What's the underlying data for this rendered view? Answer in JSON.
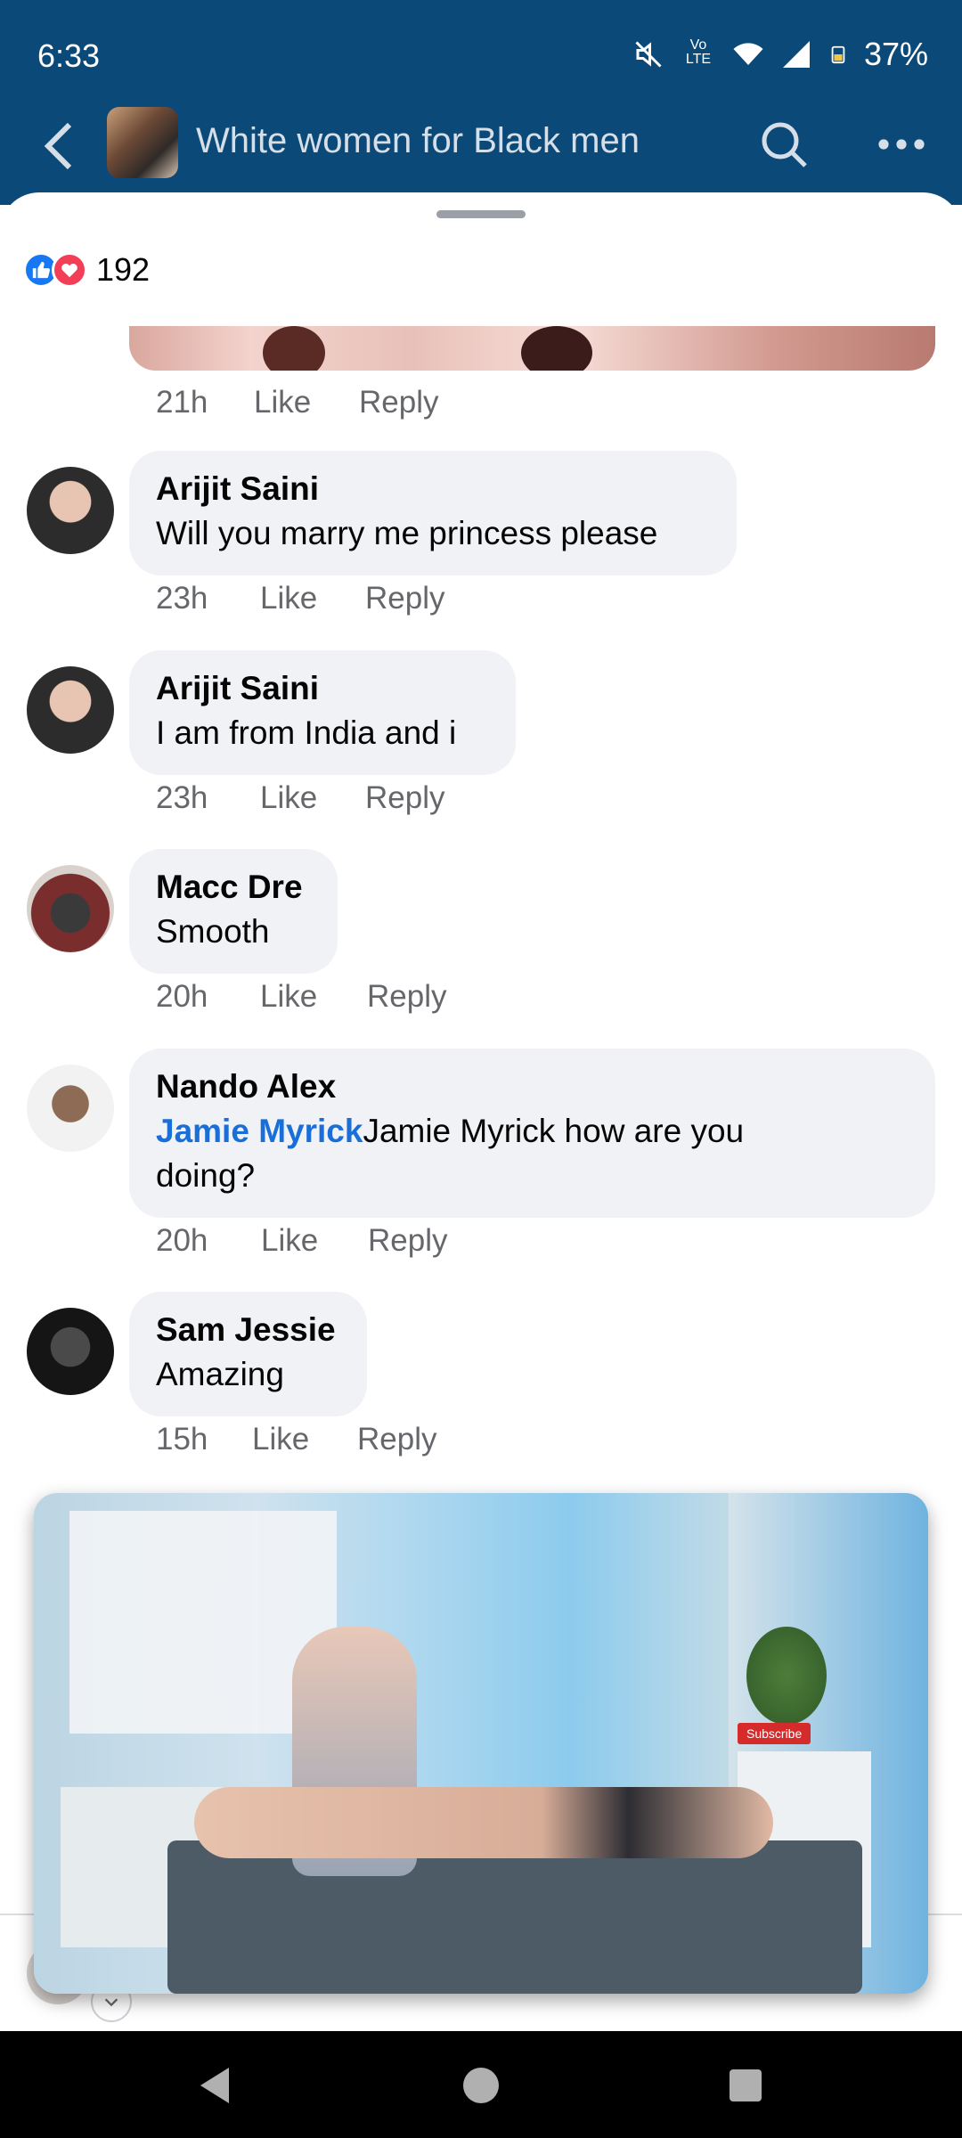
{
  "status_bar": {
    "time": "6:33",
    "network_label": "Vo LTE",
    "battery": "37%"
  },
  "header": {
    "title": "White women for Black men",
    "back_icon": "back-arrow-icon",
    "search_icon": "search-icon",
    "more_icon": "more-dots-icon"
  },
  "reactions": {
    "count": "192",
    "types": [
      "like",
      "love"
    ]
  },
  "previous_comment_meta": {
    "time": "21h",
    "like": "Like",
    "reply": "Reply"
  },
  "comments": [
    {
      "author": "Arijit Saini",
      "text": "Will you marry me princess please",
      "time": "23h",
      "like": "Like",
      "reply": "Reply"
    },
    {
      "author": "Arijit Saini",
      "text": "I am from India and i",
      "time": "23h",
      "like": "Like",
      "reply": "Reply"
    },
    {
      "author": "Macc Dre",
      "text": "Smooth",
      "time": "20h",
      "like": "Like",
      "reply": "Reply"
    },
    {
      "author": "Nando Alex",
      "mention": "Jamie Myrick",
      "text": "Jamie Myrick how are you doing?",
      "time": "20h",
      "like": "Like",
      "reply": "Reply"
    },
    {
      "author": "Sam Jessie",
      "text": "Amazing",
      "time": "15h",
      "like": "Like",
      "reply": "Reply"
    }
  ],
  "video_overlay": {
    "badge": "Subscribe"
  },
  "colors": {
    "header_bg": "#0b4a78",
    "bubble_bg": "#f0f2f5",
    "mention": "#1a6ed8",
    "meta_text": "#65676b"
  }
}
